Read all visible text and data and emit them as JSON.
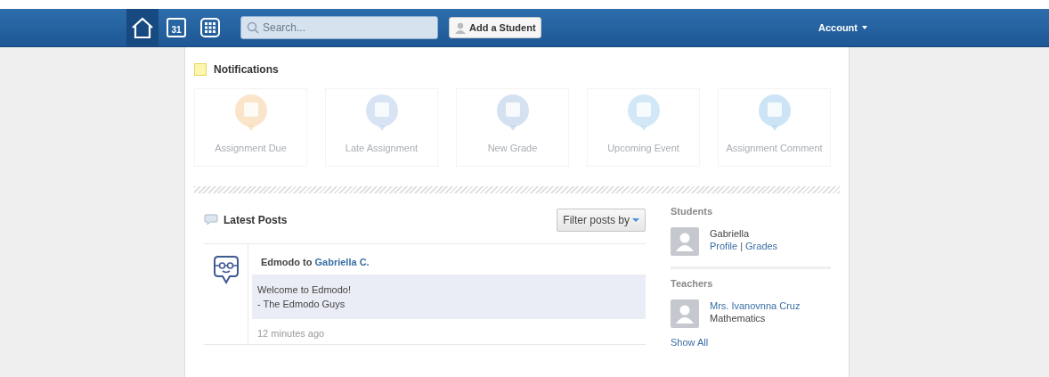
{
  "nav": {
    "icons": [
      {
        "kind": "home",
        "selected": true
      },
      {
        "kind": "calendar",
        "day": "31",
        "selected": false
      },
      {
        "kind": "apps",
        "selected": false
      }
    ],
    "search": {
      "placeholder": "Search..."
    },
    "add_button": "Add a Student",
    "account": "Account"
  },
  "notifications": {
    "title": "Notifications",
    "tiles": [
      {
        "kind": "due",
        "label": "Assignment Due"
      },
      {
        "kind": "late",
        "label": "Late Assignment"
      },
      {
        "kind": "grade",
        "label": "New Grade"
      },
      {
        "kind": "event",
        "label": "Upcoming Event"
      },
      {
        "kind": "comment",
        "label": "Assignment Comment"
      }
    ]
  },
  "posts": {
    "title": "Latest Posts",
    "filter": "Filter posts by",
    "items": [
      {
        "author": "Edmodo",
        "joiner": "to",
        "recipient": "Gabriella C.",
        "lines": [
          "Welcome to Edmodo!",
          "- The Edmodo Guys"
        ],
        "time": "12 minutes ago"
      }
    ]
  },
  "sidebar": {
    "students_title": "Students",
    "students": [
      {
        "name": "Gabriella",
        "links": [
          "Profile",
          "Grades"
        ],
        "separator": "|"
      }
    ],
    "teachers_title": "Teachers",
    "teachers": [
      {
        "name": "Mrs. Ivanovnna Cruz",
        "subject": "Mathematics"
      }
    ],
    "show_all": "Show All"
  }
}
